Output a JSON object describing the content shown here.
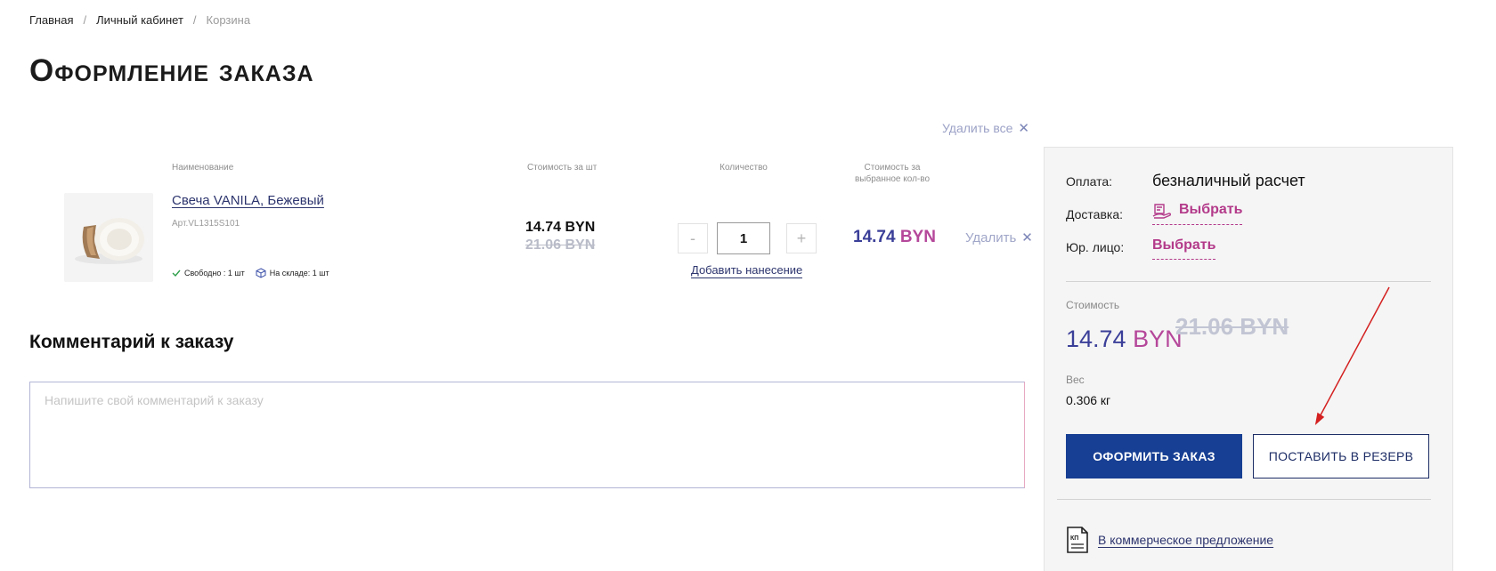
{
  "breadcrumb": {
    "items": [
      "Главная",
      "Личный кабинет"
    ],
    "separator": "/",
    "current": "Корзина"
  },
  "page_title": "Оформление заказа",
  "cart": {
    "delete_all_label": "Удалить все",
    "columns": {
      "name": "Наименование",
      "unit_price": "Стоимость за шт",
      "quantity": "Количество",
      "total_line1": "Стоимость за",
      "total_line2": "выбранное кол-во"
    },
    "items": [
      {
        "name": "Свеча VANILA, Бежевый",
        "article": "Арт.VL1315S101",
        "stock_free": "Свободно : 1 шт",
        "stock_warehouse": "На складе: 1 шт",
        "price": "14.74 BYN",
        "price_old": "21.06 BYN",
        "qty_minus": "-",
        "qty": "1",
        "qty_plus": "+",
        "add_print": "Добавить нанесение",
        "total_num": "14.74",
        "total_cur": "BYN",
        "delete_label": "Удалить"
      }
    ]
  },
  "comment": {
    "title": "Комментарий к заказу",
    "placeholder": "Напишите свой комментарий к заказу"
  },
  "summary": {
    "payment_label": "Оплата:",
    "payment_value": "безналичный расчет",
    "delivery_label": "Доставка:",
    "delivery_link": "Выбрать",
    "legal_label": "Юр. лицо:",
    "legal_link": "Выбрать",
    "cost_label": "Стоимость",
    "cost_num": "14.74",
    "cost_cur": "BYN",
    "cost_old": "21.06 BYN",
    "weight_label": "Вес",
    "weight_value": "0.306 кг",
    "order_button": "ОФОРМИТЬ ЗАКАЗ",
    "reserve_button": "ПОСТАВИТЬ В РЕЗЕРВ",
    "kp_icon_text": "КП",
    "kp_link": "В коммерческое предложение"
  },
  "colors": {
    "primary": "#173f93",
    "accent_pink": "#b33a8a",
    "price_blue": "#3b3f98",
    "annotation_arrow": "#d42020"
  }
}
